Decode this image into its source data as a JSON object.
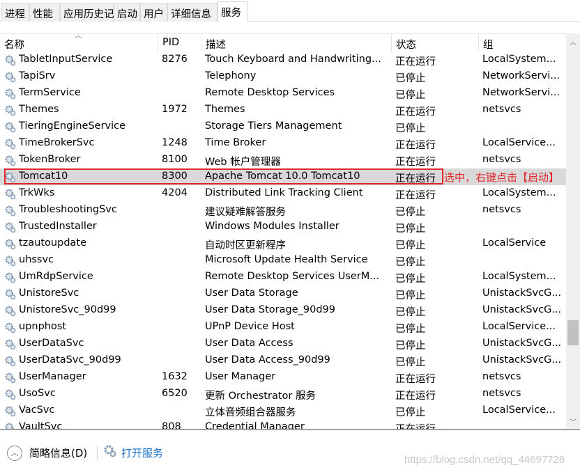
{
  "tabs": [
    "进程",
    "性能",
    "应用历史记录",
    "启动",
    "用户",
    "详细信息",
    "服务"
  ],
  "active_tab": 6,
  "columns": {
    "name": "名称",
    "pid": "PID",
    "desc": "描述",
    "status": "状态",
    "group": "组"
  },
  "rows": [
    {
      "name": "TabletInputService",
      "pid": "8276",
      "desc": "Touch Keyboard and Handwriting...",
      "status": "正在运行",
      "group": "LocalSystem..."
    },
    {
      "name": "TapiSrv",
      "pid": "",
      "desc": "Telephony",
      "status": "已停止",
      "group": "NetworkServi..."
    },
    {
      "name": "TermService",
      "pid": "",
      "desc": "Remote Desktop Services",
      "status": "已停止",
      "group": "NetworkServi..."
    },
    {
      "name": "Themes",
      "pid": "1972",
      "desc": "Themes",
      "status": "正在运行",
      "group": "netsvcs"
    },
    {
      "name": "TieringEngineService",
      "pid": "",
      "desc": "Storage Tiers Management",
      "status": "已停止",
      "group": ""
    },
    {
      "name": "TimeBrokerSvc",
      "pid": "1248",
      "desc": "Time Broker",
      "status": "正在运行",
      "group": "LocalService..."
    },
    {
      "name": "TokenBroker",
      "pid": "8100",
      "desc": "Web 帐户管理器",
      "status": "正在运行",
      "group": "netsvcs"
    },
    {
      "name": "Tomcat10",
      "pid": "8300",
      "desc": "Apache Tomcat 10.0 Tomcat10",
      "status": "正在运行",
      "group": ""
    },
    {
      "name": "TrkWks",
      "pid": "4204",
      "desc": "Distributed Link Tracking Client",
      "status": "正在运行",
      "group": "LocalSystem..."
    },
    {
      "name": "TroubleshootingSvc",
      "pid": "",
      "desc": "建议疑难解答服务",
      "status": "已停止",
      "group": "netsvcs"
    },
    {
      "name": "TrustedInstaller",
      "pid": "",
      "desc": "Windows Modules Installer",
      "status": "已停止",
      "group": ""
    },
    {
      "name": "tzautoupdate",
      "pid": "",
      "desc": "自动时区更新程序",
      "status": "已停止",
      "group": "LocalService"
    },
    {
      "name": "uhssvc",
      "pid": "",
      "desc": "Microsoft Update Health Service",
      "status": "已停止",
      "group": ""
    },
    {
      "name": "UmRdpService",
      "pid": "",
      "desc": "Remote Desktop Services UserM...",
      "status": "已停止",
      "group": "LocalSystem..."
    },
    {
      "name": "UnistoreSvc",
      "pid": "",
      "desc": "User Data Storage",
      "status": "已停止",
      "group": "UnistackSvcG..."
    },
    {
      "name": "UnistoreSvc_90d99",
      "pid": "",
      "desc": "User Data Storage_90d99",
      "status": "已停止",
      "group": "UnistackSvcG..."
    },
    {
      "name": "upnphost",
      "pid": "",
      "desc": "UPnP Device Host",
      "status": "已停止",
      "group": "LocalService..."
    },
    {
      "name": "UserDataSvc",
      "pid": "",
      "desc": "User Data Access",
      "status": "已停止",
      "group": "UnistackSvcG..."
    },
    {
      "name": "UserDataSvc_90d99",
      "pid": "",
      "desc": "User Data Access_90d99",
      "status": "已停止",
      "group": "UnistackSvcG..."
    },
    {
      "name": "UserManager",
      "pid": "1632",
      "desc": "User Manager",
      "status": "正在运行",
      "group": "netsvcs"
    },
    {
      "name": "UsoSvc",
      "pid": "6520",
      "desc": "更新 Orchestrator 服务",
      "status": "正在运行",
      "group": "netsvcs"
    },
    {
      "name": "VacSvc",
      "pid": "",
      "desc": "立体音频组合器服务",
      "status": "已停止",
      "group": "LocalService..."
    },
    {
      "name": "VaultSvc",
      "pid": "808",
      "desc": "Credential Manager",
      "status": "正在运行",
      "group": ""
    }
  ],
  "selected_row": 7,
  "annotation": "选中，右键点击【启动】",
  "annotation_color": "#e0262b",
  "footer": {
    "details": "简略信息(D)",
    "open_services": "打开服务"
  },
  "watermark": "https://blog.csdn.net/qq_44697728"
}
